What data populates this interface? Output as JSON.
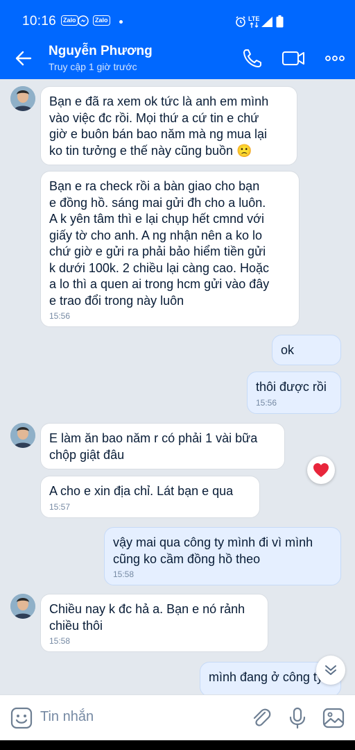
{
  "status_bar": {
    "time": "10:16",
    "apps": [
      "Zalo",
      "Zalo"
    ],
    "network": "LTE"
  },
  "header": {
    "contact_name": "Nguyễn Phương",
    "contact_status": "Truy cập 1 giờ trước"
  },
  "messages": [
    {
      "side": "in",
      "avatar": true,
      "text": "Bạn e đã ra xem ok tức là anh em mình\nvào việc đc rồi. Mọi thứ a cứ tin e chứ\ngiờ e buôn bán bao năm mà ng mua lại\nko tin tưởng e thế này cũng buồn 🙁",
      "time": ""
    },
    {
      "side": "in",
      "avatar": false,
      "text": "Bạn e ra check rồi a bàn giao cho bạn\ne đồng hồ. sáng mai gửi đh cho a luôn.\nA k yên tâm thì e lại chụp hết cmnd với\ngiấy tờ cho anh. A ng nhận nên a ko lo\nchứ giờ e gửi ra phải bảo hiểm tiền gửi\nk dưới 100k. 2 chiều lại càng cao. Hoặc\na lo thì a quen ai trong hcm gửi vào đây\ne trao đổi trong này luôn",
      "time": "15:56"
    },
    {
      "side": "out",
      "text": "ok",
      "time": ""
    },
    {
      "side": "out",
      "text": "thôi được rồi",
      "time": "15:56"
    },
    {
      "side": "in",
      "avatar": true,
      "text": "E làm ăn bao năm r có phải 1 vài bữa\nchộp giật đâu",
      "time": ""
    },
    {
      "side": "in",
      "avatar": false,
      "text": "A cho e xin địa chỉ. Lát bạn e qua",
      "time": "15:57"
    },
    {
      "side": "out",
      "text": "vậy mai qua công ty mình đi vì mình\ncũng ko cầm đồng hồ theo",
      "time": "15:58"
    },
    {
      "side": "in",
      "avatar": true,
      "text": "Chiều nay k đc hả a. Bạn e nó rảnh\nchiều thôi",
      "time": "15:58"
    },
    {
      "side": "out",
      "text": "mình đang ở công ty",
      "time": ""
    }
  ],
  "input": {
    "placeholder": "Tin nhắn"
  },
  "colors": {
    "header_bg": "#0068ff",
    "chat_bg": "#e3e8ee",
    "incoming_bubble": "#ffffff",
    "outgoing_bubble": "#e5efff",
    "reaction": "#e8253b"
  }
}
